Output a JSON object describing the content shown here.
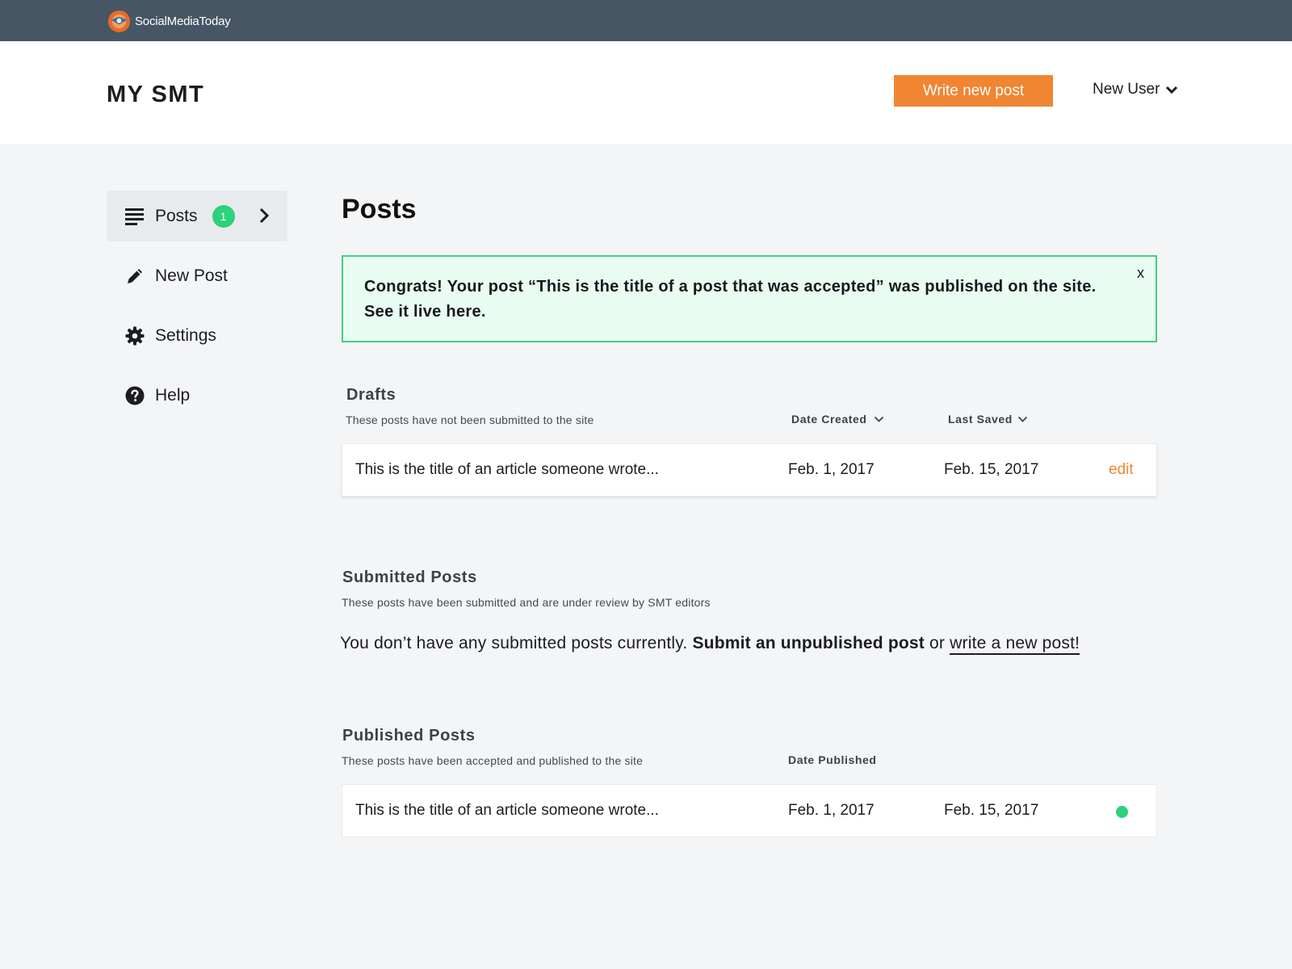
{
  "topbar": {
    "brand_name": "SocialMediaToday",
    "logo_icon": "smt-logo-icon"
  },
  "header": {
    "title": "MY SMT",
    "write_button": "Write new post",
    "user_menu": "New User"
  },
  "nav": {
    "items": [
      {
        "label": "Posts",
        "icon": "list-icon",
        "badge": "1",
        "active": true
      },
      {
        "label": "New Post",
        "icon": "pencil-icon"
      },
      {
        "label": "Settings",
        "icon": "gear-icon"
      },
      {
        "label": "Help",
        "icon": "help-icon"
      }
    ]
  },
  "main": {
    "title": "Posts",
    "alert": {
      "message": "Congrats! Your post “This is the title of a post that was accepted” was published on the site. See it live here.",
      "close_label": "x"
    },
    "drafts": {
      "title": "Drafts",
      "subtitle": "These posts have not been submitted to the site",
      "columns": [
        "Date Created",
        "Last Saved"
      ],
      "rows": [
        {
          "title": "This is the title of an article someone wrote...",
          "date_created": "Feb. 1, 2017",
          "last_saved": "Feb. 15, 2017",
          "action": "edit"
        }
      ]
    },
    "submitted": {
      "title": "Submitted Posts",
      "subtitle": "These posts have been submitted and are under review by SMT editors",
      "empty_prefix": "You don’t have any submitted posts currently.",
      "empty_link_bold": "Submit an unpublished post",
      "empty_or": "or",
      "empty_link_new": "write a new post!"
    },
    "published": {
      "title": "Published Posts",
      "subtitle": "These posts have been accepted and published to the site",
      "columns": [
        "Date Published"
      ],
      "rows": [
        {
          "title": "This is the title of an article someone wrote...",
          "date_1": "Feb. 1, 2017",
          "date_2": "Feb. 15, 2017",
          "status": "published"
        }
      ]
    }
  },
  "colors": {
    "topbar": "#465665",
    "accent": "#f08532",
    "success": "#2ed17c",
    "alert_bg": "#e8fcf1",
    "alert_border": "#40cf82",
    "page_bg": "#f4f5f7"
  }
}
